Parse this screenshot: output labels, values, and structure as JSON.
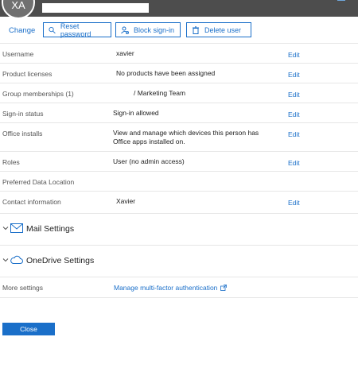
{
  "header": {
    "avatar_initials": "XA"
  },
  "actions": {
    "change_label": "Change",
    "reset_password_label": "Reset password",
    "block_signin_label": "Block sign-in",
    "delete_user_label": "Delete user"
  },
  "details": {
    "edit_label": "Edit",
    "username": {
      "label": "Username",
      "value": "xavier"
    },
    "product_licenses": {
      "label": "Product licenses",
      "value": "No products have been assigned"
    },
    "group_memberships": {
      "label": "Group memberships (1)",
      "value": "/ Marketing Team"
    },
    "signin_status": {
      "label": "Sign-in status",
      "value": "Sign-in allowed"
    },
    "office_installs": {
      "label": "Office installs",
      "value_line1": "View and manage which devices this person has",
      "value_line2": "Office apps installed on."
    },
    "roles": {
      "label": "Roles",
      "value": "User (no admin access)"
    },
    "preferred_data_location": {
      "label": "Preferred Data Location"
    },
    "contact_information": {
      "label": "Contact information",
      "value": "Xavier"
    }
  },
  "sections": {
    "mail_settings": "Mail Settings",
    "onedrive_settings": "OneDrive Settings"
  },
  "more_settings": {
    "label": "More settings",
    "mfa_link": "Manage multi-factor authentication"
  },
  "footer": {
    "close_label": "Close"
  },
  "colors": {
    "accent": "#1a6fc9",
    "topbar": "#4d4d4d",
    "avatar": "#707070"
  }
}
